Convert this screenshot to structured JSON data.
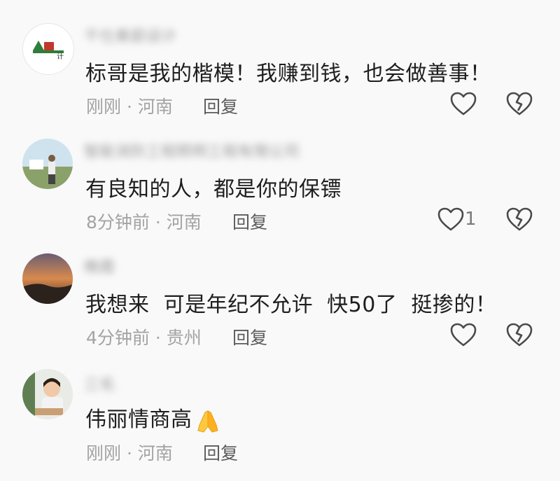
{
  "comments": [
    {
      "username": "千仕美庭设计",
      "avatar_text": "计",
      "text": "标哥是我的楷模！我赚到钱，也会做善事！",
      "time": "刚刚",
      "location": "河南",
      "reply_label": "回复",
      "like_count": ""
    },
    {
      "username": "智能消防工程照明工程有限公司",
      "text": "有良知的人，都是你的保镖",
      "time": "8分钟前",
      "location": "河南",
      "reply_label": "回复",
      "like_count": "1"
    },
    {
      "username": "晚霞",
      "text": "我想来  可是年纪不允许  快50了  挺掺的！",
      "time": "4分钟前",
      "location": "贵州",
      "reply_label": "回复",
      "like_count": ""
    },
    {
      "username": "三毛",
      "text": "伟丽情商高",
      "time": "刚刚",
      "location": "河南",
      "reply_label": "回复",
      "like_count": ""
    }
  ],
  "separator": "·",
  "icons": {
    "like": "heart-outline-icon",
    "dislike": "broken-heart-icon",
    "emoji": "folded-hands-emoji"
  }
}
